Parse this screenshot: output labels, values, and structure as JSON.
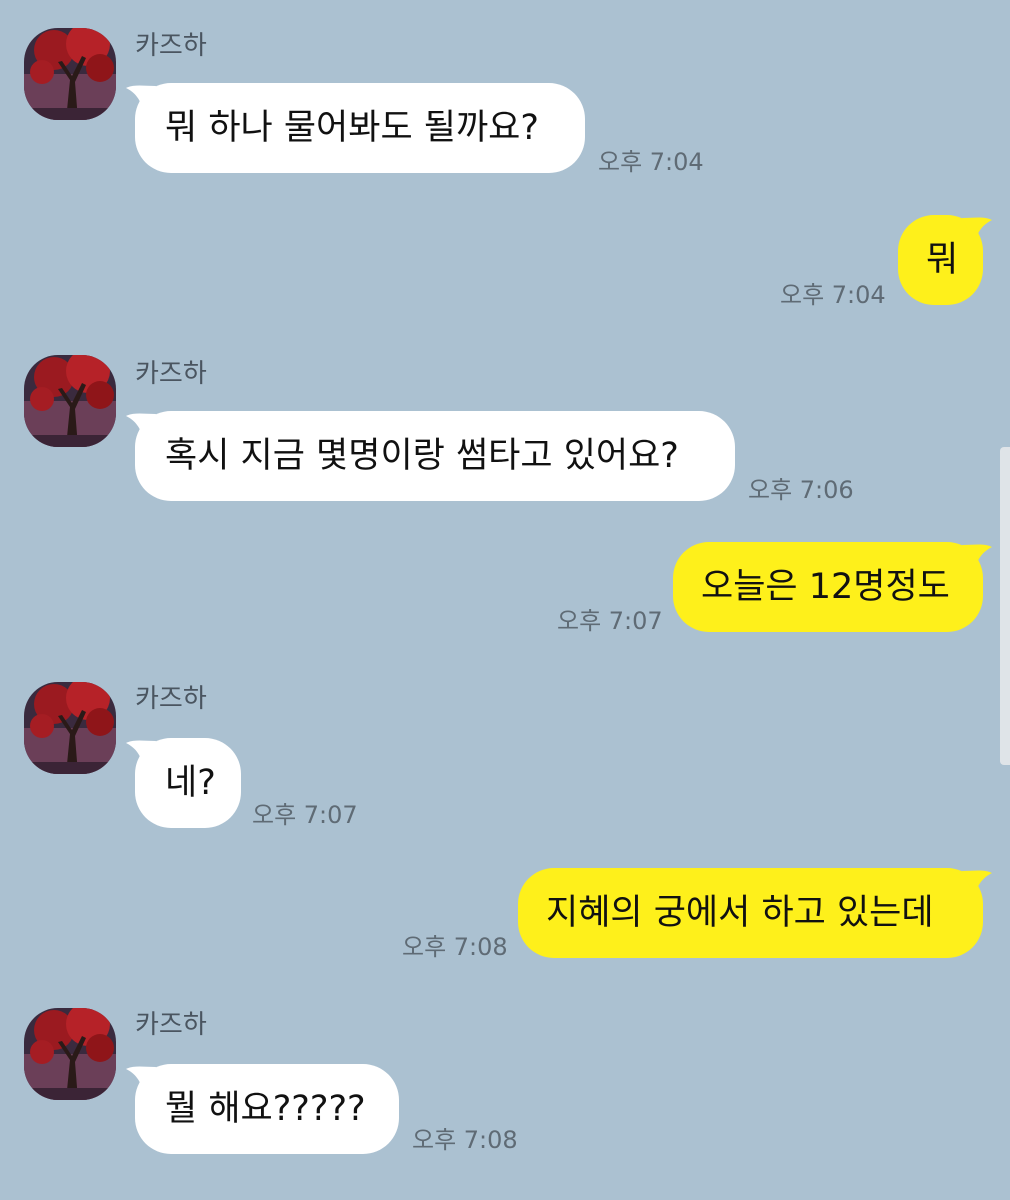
{
  "chat": {
    "sender_name": "카즈하",
    "messages": [
      {
        "from": "them",
        "text": "뭐 하나 물어봐도 될까요?",
        "time": "오후 7:04"
      },
      {
        "from": "me",
        "text": "뭐",
        "time": "오후 7:04"
      },
      {
        "from": "them",
        "text": "혹시 지금 몇명이랑 썸타고 있어요?",
        "time": "오후 7:06"
      },
      {
        "from": "me",
        "text": "오늘은 12명정도",
        "time": "오후 7:07"
      },
      {
        "from": "them",
        "text": "네?",
        "time": "오후 7:07"
      },
      {
        "from": "me",
        "text": "지혜의 궁에서 하고 있는데",
        "time": "오후 7:08"
      },
      {
        "from": "them",
        "text": "뭘 해요?????",
        "time": "오후 7:08"
      }
    ]
  },
  "colors": {
    "background": "#abc1d1",
    "incoming_bubble": "#ffffff",
    "outgoing_bubble": "#fef01b"
  }
}
